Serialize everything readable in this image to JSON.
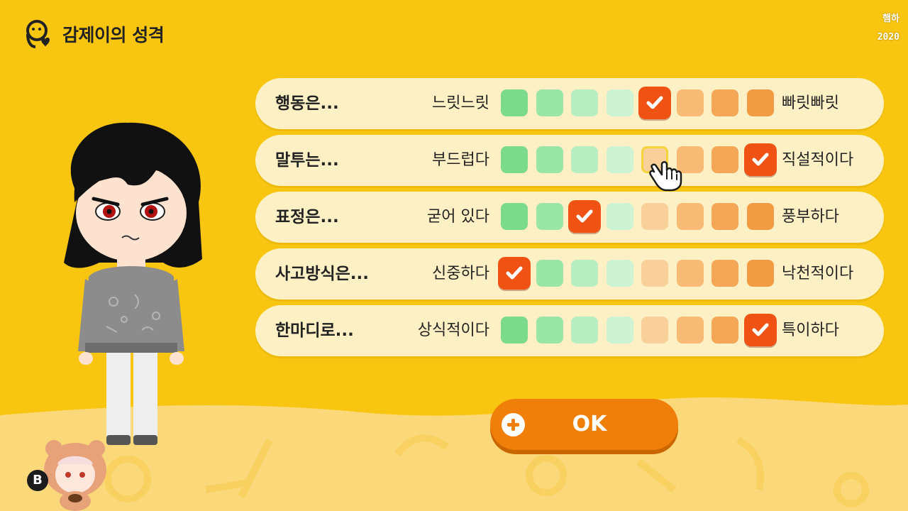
{
  "header": {
    "title": "감제이의 성격",
    "icon": "person-heart-icon"
  },
  "watermark": {
    "line1": "햄하",
    "line2": "2020"
  },
  "traits": [
    {
      "label": "행동은...",
      "left": "느릿느릿",
      "right": "빠릿빠릿",
      "selected": 5
    },
    {
      "label": "말투는...",
      "left": "부드럽다",
      "right": "직설적이다",
      "selected": 8,
      "hovered": 5
    },
    {
      "label": "표정은...",
      "left": "굳어 있다",
      "right": "풍부하다",
      "selected": 3
    },
    {
      "label": "사고방식은...",
      "left": "신중하다",
      "right": "낙천적이다",
      "selected": 1
    },
    {
      "label": "한마디로...",
      "left": "상식적이다",
      "right": "특이하다",
      "selected": 8
    }
  ],
  "scale": {
    "steps": 8,
    "colors": [
      "#7cda8c",
      "#99e6a6",
      "#b7eec1",
      "#cdf3d3",
      "#f9cf9a",
      "#f7bb76",
      "#f5a657",
      "#f29c43"
    ],
    "checked_color": "#f05214"
  },
  "ok_button": {
    "label": "OK",
    "icon": "plus-circle-icon"
  },
  "back_badge": {
    "label": "B"
  },
  "colors": {
    "background": "#f8c511",
    "row_bg": "#fdf0c4",
    "accent": "#f07f0a"
  }
}
